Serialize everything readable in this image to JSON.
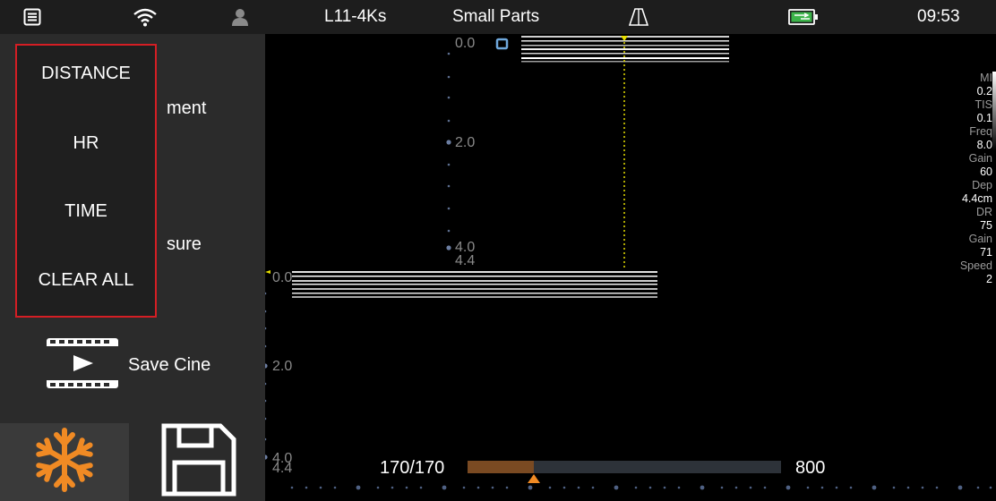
{
  "status_bar": {
    "probe": "L11-4Ks",
    "preset": "Small Parts",
    "time": "09:53",
    "icons": [
      "menu-icon",
      "wifi-icon",
      "user-icon",
      "probe-icon",
      "battery-icon"
    ]
  },
  "left_panel": {
    "partial_label_1": "ment",
    "partial_label_2": "sure",
    "popup_menu": [
      "DISTANCE",
      "HR",
      "TIME",
      "CLEAR ALL"
    ],
    "save_cine": "Save Cine"
  },
  "image": {
    "top_scale": [
      "0.0",
      "2.0",
      "4.0",
      "4.4"
    ],
    "bottom_scale": [
      "0.0",
      "2.0",
      "4.0",
      "4.4"
    ]
  },
  "params": [
    {
      "label": "MI",
      "value": "0.2"
    },
    {
      "label": "TIS",
      "value": "0.1"
    },
    {
      "label": "Freq",
      "value": "8.0"
    },
    {
      "label": "Gain",
      "value": "60"
    },
    {
      "label": "Dep",
      "value": "4.4cm"
    },
    {
      "label": "DR",
      "value": "75"
    },
    {
      "label": "Gain",
      "value": "71"
    },
    {
      "label": "Speed",
      "value": "2"
    }
  ],
  "cine": {
    "counter": "170/170",
    "total": "800",
    "progress": 0.21
  },
  "colors": {
    "accent_red": "#d41e24",
    "freeze_orange": "#f08a24",
    "cine_fill": "#7a4a22",
    "marker_yellow": "#e8e000"
  }
}
